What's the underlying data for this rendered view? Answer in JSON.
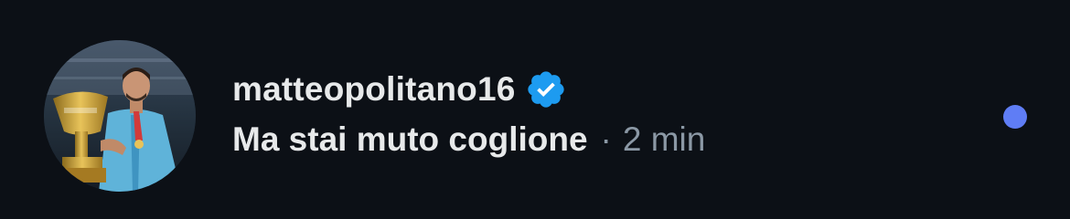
{
  "conversation": {
    "username": "matteopolitano16",
    "verified_icon": "verified-badge-icon",
    "message": "Ma stai muto coglione",
    "separator": "·",
    "time": "2 min",
    "unread": true
  },
  "colors": {
    "background": "#0c1016",
    "primary_text": "#e7e9ea",
    "secondary_text": "#8b98a5",
    "verified_blue": "#1d9bf0",
    "unread_dot": "#5f7df5"
  }
}
